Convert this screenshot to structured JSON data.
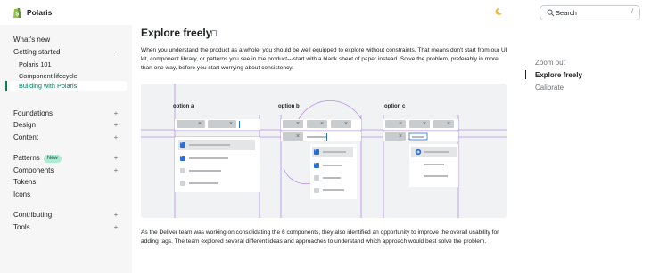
{
  "header": {
    "brand": "Polaris",
    "search_placeholder": "Search",
    "search_shortcut": "/"
  },
  "sidebar": {
    "items": [
      {
        "label": "What's new"
      },
      {
        "label": "Getting started",
        "expanded": true
      },
      {
        "label": "Polaris 101"
      },
      {
        "label": "Component lifecycle"
      },
      {
        "label": "Building with Polaris",
        "active": true
      },
      {
        "label": "Foundations"
      },
      {
        "label": "Design"
      },
      {
        "label": "Content"
      },
      {
        "label": "Patterns",
        "badge": "New"
      },
      {
        "label": "Components"
      },
      {
        "label": "Tokens"
      },
      {
        "label": "Icons"
      },
      {
        "label": "Contributing"
      },
      {
        "label": "Tools"
      }
    ],
    "expand_symbol": "+",
    "collapse_symbol": "-"
  },
  "main": {
    "title": "Explore freely",
    "paragraph_1": "When you understand the product as a whole, you should be well equipped to explore without constraints. That means don't start from our UI kit, component library, or patterns you see in the product---start with a blank sheet of paper instead. Solve the problem, preferably in more than one way, before you start worrying about consistency.",
    "paragraph_2": "As the Deliver team was working on consolidating the 6 components, they also identified an opportunity to improve the overall usability for adding tags. The team explored several different ideas and approaches to understand which approach would best solve the problem.",
    "figure": {
      "options": [
        "option a",
        "option b",
        "option c"
      ],
      "tag_close": "×"
    }
  },
  "toc": {
    "items": [
      "Zoom out",
      "Explore freely",
      "Calibrate"
    ],
    "active": "Explore freely"
  },
  "colors": {
    "accent_green": "#007f5f",
    "guide_purple": "#b58ef0",
    "check_blue": "#2c6ecb",
    "sidebar_bg": "#f6f6f7",
    "figure_bg": "#f1f2f3"
  },
  "icons": [
    "polaris-logo-icon",
    "moon-icon",
    "search-icon",
    "page-icon"
  ]
}
